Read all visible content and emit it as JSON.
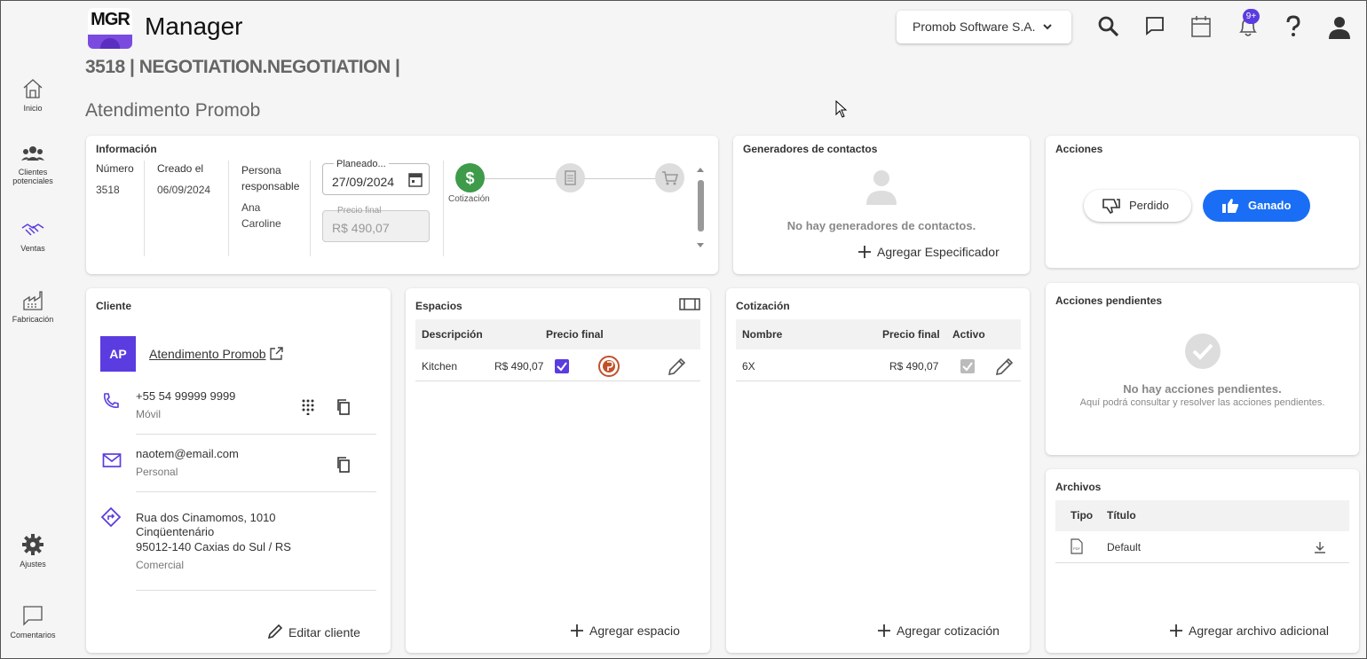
{
  "app": {
    "logo_text": "MGR",
    "title": "Manager"
  },
  "header": {
    "company": "Promob Software S.A.",
    "notification_badge": "9+"
  },
  "sidebar": {
    "items": [
      {
        "label": "Inicio"
      },
      {
        "label": "Clientes potenciales"
      },
      {
        "label": "Ventas"
      },
      {
        "label": "Fabricación"
      },
      {
        "label": "Ajustes"
      },
      {
        "label": "Comentarios"
      }
    ]
  },
  "page": {
    "title": "3518 | NEGOTIATION.NEGOTIATION |",
    "subtitle": "Atendimento Promob"
  },
  "info": {
    "title": "Información",
    "numero_label": "Número",
    "numero": "3518",
    "creado_label": "Creado el",
    "creado": "06/09/2024",
    "persona_label": "Persona responsable",
    "persona": "Ana Caroline",
    "planeado_label": "Planeado...",
    "planeado": "27/09/2024",
    "precio_label": "Precio final",
    "precio": "R$ 490,07",
    "step_label": "Cotización"
  },
  "contacts": {
    "title": "Generadores de contactos",
    "empty": "No hay generadores de contactos.",
    "add": "Agregar Especificador"
  },
  "acciones": {
    "title": "Acciones",
    "lost": "Perdido",
    "won": "Ganado"
  },
  "cliente": {
    "title": "Cliente",
    "avatar": "AP",
    "name": "Atendimento Promob",
    "phone": "+55 54 99999 9999",
    "phone_type": "Móvil",
    "email": "naotem@email.com",
    "email_type": "Personal",
    "address_1": "Rua dos Cinamomos, 1010",
    "address_2": "Cinqüentenário",
    "address_3": "95012-140 Caxias do Sul / RS",
    "address_type": "Comercial",
    "edit": "Editar cliente"
  },
  "espacios": {
    "title": "Espacios",
    "col_desc": "Descripción",
    "col_precio": "Precio final",
    "rows": [
      {
        "desc": "Kitchen",
        "precio": "R$ 490,07"
      }
    ],
    "add": "Agregar espacio"
  },
  "cotizacion": {
    "title": "Cotización",
    "col_nombre": "Nombre",
    "col_precio": "Precio final",
    "col_activo": "Activo",
    "rows": [
      {
        "nombre": "6X",
        "precio": "R$ 490,07"
      }
    ],
    "add": "Agregar cotización"
  },
  "pendientes": {
    "title": "Acciones pendientes",
    "empty": "No hay acciones pendientes.",
    "sub": "Aquí podrá consultar y resolver las acciones pendientes."
  },
  "archivos": {
    "title": "Archivos",
    "col_tipo": "Tipo",
    "col_titulo": "Título",
    "rows": [
      {
        "titulo": "Default"
      }
    ],
    "add": "Agregar archivo adicional"
  },
  "colors": {
    "accent": "#5b3ce0",
    "won": "#1a6ef5",
    "step_active": "#3d9b4a"
  }
}
